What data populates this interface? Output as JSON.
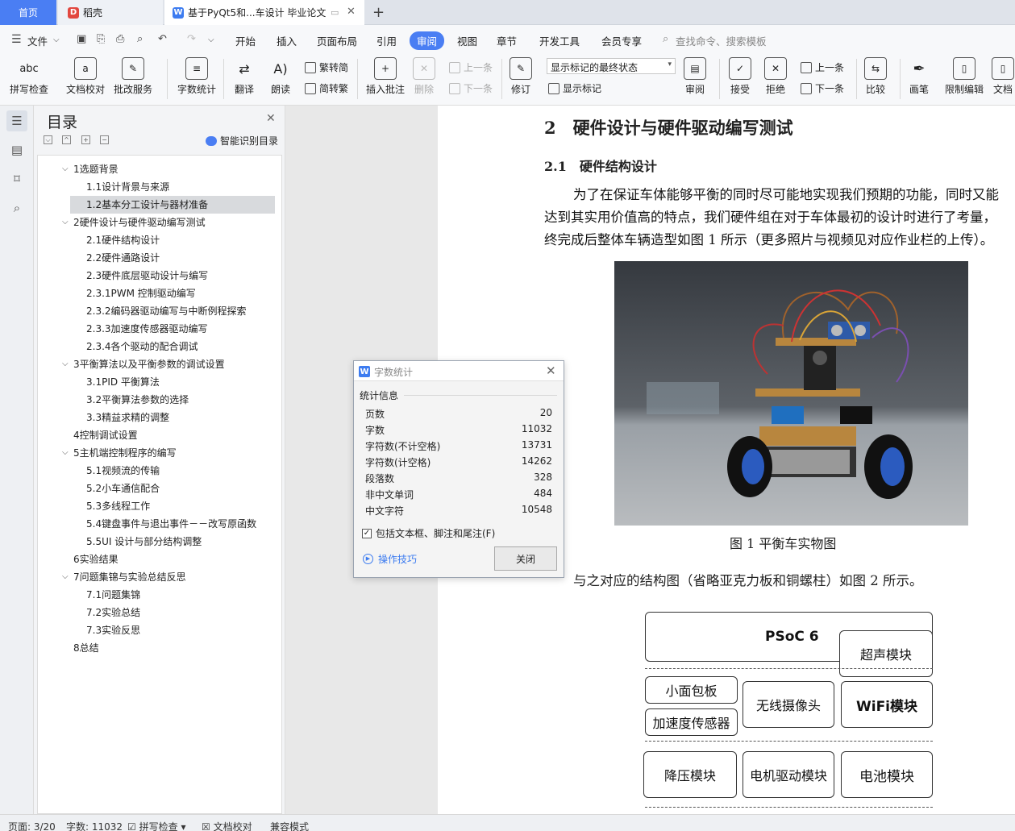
{
  "tabs": {
    "home": "首页",
    "docer": "稻壳",
    "doc": "基于PyQt5和...车设计 毕业论文",
    "add": "+"
  },
  "menu": {
    "file": "文件",
    "items": [
      "开始",
      "插入",
      "页面布局",
      "引用",
      "审阅",
      "视图",
      "章节",
      "开发工具",
      "会员专享"
    ],
    "search": "查找命令、搜索模板"
  },
  "ribbon": {
    "spell": "拼写检查",
    "proof": "文档校对",
    "service": "批改服务",
    "wordcount": "字数统计",
    "translate": "翻译",
    "read": "朗读",
    "trad": "繁转简",
    "simp": "简转繁",
    "insert_comment": "插入批注",
    "delete": "删除",
    "prev_comment": "上一条",
    "next_comment": "下一条",
    "revise": "修订",
    "markup_state": "显示标记的最终状态",
    "show_markup": "显示标记",
    "review_pane": "审阅",
    "accept": "接受",
    "reject": "拒绝",
    "prev_change": "上一条",
    "next_change": "下一条",
    "compare": "比较",
    "pen": "画笔",
    "restrict": "限制编辑",
    "doc_rights": "文档"
  },
  "toc": {
    "title": "目录",
    "smart": "智能识别目录",
    "items": [
      {
        "label": "1选题背景",
        "level": 1,
        "caret": true
      },
      {
        "label": "1.1设计背景与来源",
        "level": 2
      },
      {
        "label": "1.2基本分工设计与器材准备",
        "level": 2,
        "selected": true
      },
      {
        "label": "2硬件设计与硬件驱动编写测试",
        "level": 1,
        "caret": true
      },
      {
        "label": "2.1硬件结构设计",
        "level": 2
      },
      {
        "label": "2.2硬件通路设计",
        "level": 2
      },
      {
        "label": "2.3硬件底层驱动设计与编写",
        "level": 2
      },
      {
        "label": "2.3.1PWM 控制驱动编写",
        "level": 2
      },
      {
        "label": "2.3.2编码器驱动编写与中断例程探索",
        "level": 2
      },
      {
        "label": "2.3.3加速度传感器驱动编写",
        "level": 2
      },
      {
        "label": "2.3.4各个驱动的配合调试",
        "level": 2
      },
      {
        "label": "3平衡算法以及平衡参数的调试设置",
        "level": 1,
        "caret": true
      },
      {
        "label": "3.1PID 平衡算法",
        "level": 2
      },
      {
        "label": "3.2平衡算法参数的选择",
        "level": 2
      },
      {
        "label": "3.3精益求精的调整",
        "level": 2
      },
      {
        "label": "4控制调试设置",
        "level": 1
      },
      {
        "label": "5主机端控制程序的编写",
        "level": 1,
        "caret": true
      },
      {
        "label": "5.1视频流的传输",
        "level": 2
      },
      {
        "label": "5.2小车通信配合",
        "level": 2
      },
      {
        "label": "5.3多线程工作",
        "level": 2
      },
      {
        "label": "5.4键盘事件与退出事件－－改写原函数",
        "level": 2
      },
      {
        "label": "5.5UI 设计与部分结构调整",
        "level": 2
      },
      {
        "label": "6实验结果",
        "level": 1
      },
      {
        "label": "7问题集锦与实验总结反思",
        "level": 1,
        "caret": true
      },
      {
        "label": "7.1问题集锦",
        "level": 2
      },
      {
        "label": "7.2实验总结",
        "level": 2
      },
      {
        "label": "7.3实验反思",
        "level": 2
      },
      {
        "label": "8总结",
        "level": 1
      }
    ]
  },
  "document": {
    "heading1": "2　硬件设计与硬件驱动编写测试",
    "heading2": "2.1　硬件结构设计",
    "para1": "为了在保证车体能够平衡的同时尽可能地实现我们预期的功能，同时又能",
    "para2": "达到其实用价值高的特点，我们硬件组在对于车体最初的设计时进行了考量，",
    "para3": "终完成后整体车辆造型如图 1 所示（更多照片与视频见对应作业栏的上传）。",
    "caption1": "图 1  平衡车实物图",
    "para4": "与之对应的结构图（省略亚克力板和铜螺柱）如图 2 所示。",
    "diagram": {
      "psoc": "PSoC 6",
      "ultrasonic": "超声模块",
      "panel": "小面包板",
      "accel": "加速度传感器",
      "camera": "无线摄像头",
      "wifi": "WiFi模块",
      "buck": "降压模块",
      "motor": "电机驱动模块",
      "battery": "电池模块"
    }
  },
  "dialog": {
    "title": "字数统计",
    "section": "统计信息",
    "rows": [
      {
        "label": "页数",
        "value": "20"
      },
      {
        "label": "字数",
        "value": "11032"
      },
      {
        "label": "字符数(不计空格)",
        "value": "13731"
      },
      {
        "label": "字符数(计空格)",
        "value": "14262"
      },
      {
        "label": "段落数",
        "value": "328"
      },
      {
        "label": "非中文单词",
        "value": "484"
      },
      {
        "label": "中文字符",
        "value": "10548"
      }
    ],
    "checkbox": "包括文本框、脚注和尾注(F)",
    "tips": "操作技巧",
    "close": "关闭"
  },
  "status": {
    "page": "页面: 3/20",
    "words": "字数: 11032",
    "spell": "拼写检查",
    "proof": "文档校对",
    "mode": "兼容模式"
  }
}
